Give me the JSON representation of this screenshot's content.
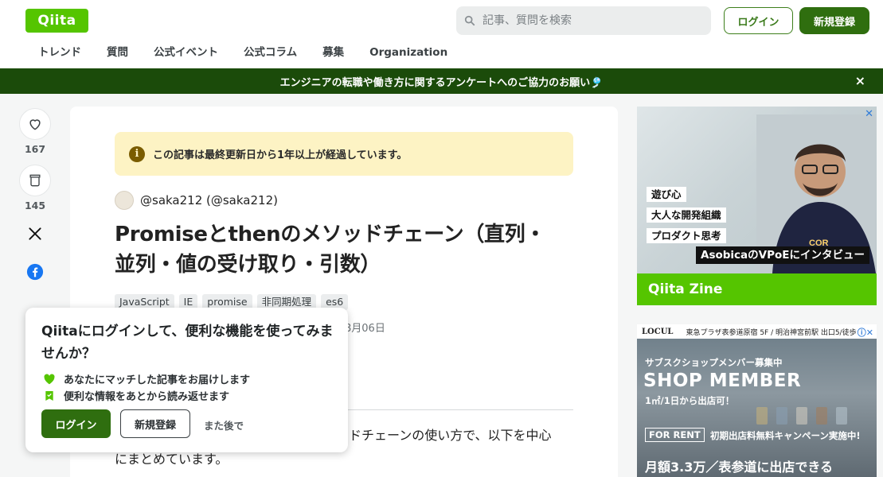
{
  "header": {
    "logo": "Qiita",
    "search_placeholder": "記事、質問を検索",
    "login": "ログイン",
    "signup": "新規登録",
    "nav": [
      "トレンド",
      "質問",
      "公式イベント",
      "公式コラム",
      "募集",
      "Organization"
    ]
  },
  "banner": {
    "text": "エンジニアの転職や働き方に関するアンケートへのご協力のお願い🎐",
    "close": "×"
  },
  "side": {
    "likes": "167",
    "stocks": "145"
  },
  "article": {
    "notice": "この記事は最終更新日から1年以上が経過しています。",
    "author": "@saka212 (@saka212)",
    "title": "Promiseとthenのメソッドチェーン（直列・並列・値の受け取り・引数）",
    "tags": [
      "JavaScript",
      "IE",
      "promise",
      "非同期処理",
      "es6"
    ],
    "date_fragment": "8月06日",
    "body_line1": "ドチェーンの使い方で、以下を中心",
    "body_line2": "にまとめています。"
  },
  "popup": {
    "title": "Qiitaにログインして、便利な機能を使ってみませんか？",
    "benefit1": "あなたにマッチした記事をお届けします",
    "benefit2": "便利な情報をあとから読み返せます",
    "login": "ログイン",
    "signup": "新規登録",
    "later": "また後で"
  },
  "ad1": {
    "lines": [
      "遊び心",
      "大人な開発組織",
      "プロダクト思考"
    ],
    "caption": "AsobicaのVPoEにインタビュー",
    "footer": "Qiita Zine",
    "close": "✕"
  },
  "ad2": {
    "brand": "LOCUL",
    "top_text": "東急プラザ表参道原宿 5F / 明治神宮前駅 出口5/徒歩",
    "sub": "サブスクショップメンバー募集中",
    "big": "SHOP MEMBER",
    "small": "1㎡/1日から出店可！",
    "forrent": "FOR RENT",
    "campaign": "初期出店料無料キャンペーン実施中!",
    "footer": "月額3.3万／表参道に出店できる",
    "info": "ⓘ✕"
  },
  "colors": {
    "brand_green": "#55c500",
    "dark_green": "#2f6e0f",
    "banner_green": "#1b4b0a",
    "notice_yellow": "#fdf3c4"
  }
}
